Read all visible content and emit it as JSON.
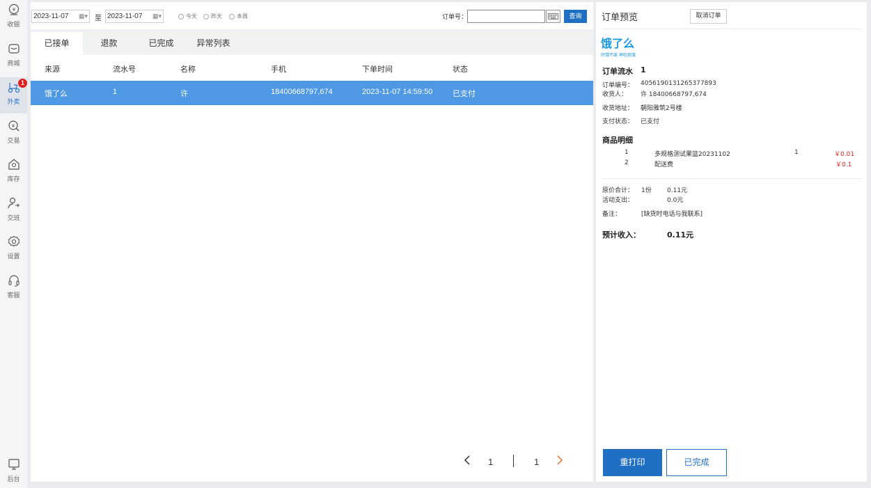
{
  "sidebar": {
    "items": [
      {
        "label": "收银",
        "icon": "cashier-icon"
      },
      {
        "label": "商城",
        "icon": "mall-icon"
      },
      {
        "label": "外卖",
        "icon": "takeout-icon",
        "badge": "1"
      },
      {
        "label": "交易",
        "icon": "yen-search-icon"
      },
      {
        "label": "库存",
        "icon": "inventory-icon"
      },
      {
        "label": "交班",
        "icon": "shift-icon"
      },
      {
        "label": "设置",
        "icon": "gear-icon"
      },
      {
        "label": "客服",
        "icon": "headset-icon"
      }
    ],
    "backend": {
      "label": "后台",
      "icon": "monitor-icon"
    }
  },
  "filter": {
    "date_from": "2023-11-07",
    "to_label": "至",
    "date_to": "2023-11-07",
    "radios": [
      "今天",
      "昨天",
      "本周"
    ],
    "order_no_label": "订单号：",
    "order_no_value": "",
    "query_label": "查询"
  },
  "tabs": [
    "已接单",
    "退款",
    "已完成",
    "异常列表"
  ],
  "table": {
    "headers": [
      "来源",
      "流水号",
      "名称",
      "手机",
      "下单时间",
      "状态"
    ],
    "rows": [
      [
        "饿了么",
        "1",
        "许",
        "18400668797,674",
        "2023-11-07 14:59:50",
        "已支付"
      ]
    ]
  },
  "pager": {
    "current": "1",
    "total": "1"
  },
  "preview": {
    "title": "订单预览",
    "cancel_label": "取消订单",
    "logo_name": "饿了么",
    "logo_slogan": "好饿不废 再吃就饿",
    "flow_label": "订单流水",
    "flow_value": "1",
    "order_no_label": "订单编号：",
    "order_no_value": "4056190131265377893",
    "receiver_label": "收货人：",
    "receiver_value": "许  18400668797,674",
    "address_label": "收货地址：",
    "address_value": "朝阳雅筑2号楼",
    "pay_label": "支付状态：",
    "pay_value": "已支付",
    "items_title": "商品明细",
    "items": [
      {
        "no": "1",
        "name": "多规格测试果篮20231102",
        "qty": "1",
        "price": "￥0.01"
      },
      {
        "no": "2",
        "name": "配送费",
        "qty": "",
        "price": "￥0.1"
      }
    ],
    "total_label": "原价合计：",
    "total_qty": "1份",
    "total_value": "0.11元",
    "promo_label": "活动支出：",
    "promo_value": "0.0元",
    "remark_label": "备注：",
    "remark_value": "[缺货时电话与我联系]",
    "income_label": "预计收入：",
    "income_value": "0.11元",
    "reprint_label": "重打印",
    "done_label": "已完成"
  },
  "colors": {
    "accent": "#1f6fc5",
    "row_selected": "#4f98e4",
    "badge": "#e02020",
    "price": "#e0251c",
    "logo": "#1a98e0"
  }
}
